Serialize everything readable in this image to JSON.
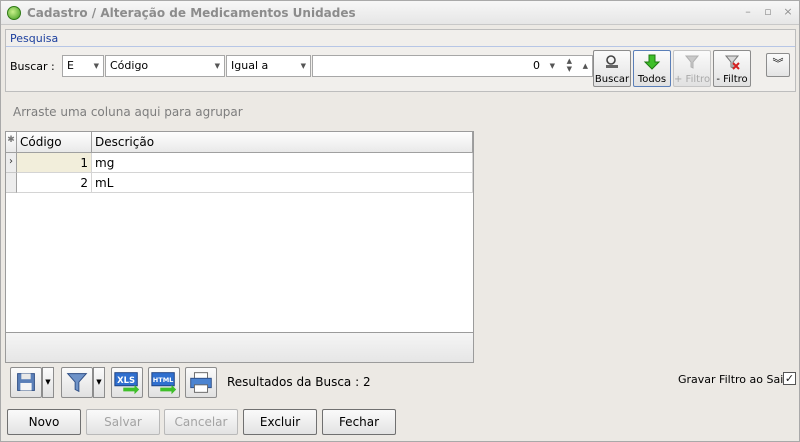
{
  "window": {
    "title": "Cadastro / Alteração de Medicamentos Unidades"
  },
  "pesquisa": {
    "label": "Pesquisa",
    "buscar_label": "Buscar :",
    "logic": "E",
    "field": "Código",
    "operator": "Igual a",
    "value": "0",
    "buttons": {
      "buscar": "Buscar",
      "todos": "Todos",
      "add_filtro": "+ Filtro",
      "remove_filtro": "- Filtro"
    }
  },
  "grid": {
    "group_hint": "Arraste uma coluna aqui para agrupar",
    "columns": [
      "Código",
      "Descrição"
    ],
    "rows": [
      {
        "codigo": "1",
        "descricao": "mg"
      },
      {
        "codigo": "2",
        "descricao": "mL"
      }
    ]
  },
  "status": {
    "resultados": "Resultados da Busca : 2",
    "gravar_filtro": "Gravar Filtro ao Sair",
    "gravar_checked": "✓"
  },
  "actions": {
    "novo": "Novo",
    "salvar": "Salvar",
    "cancelar": "Cancelar",
    "excluir": "Excluir",
    "fechar": "Fechar"
  }
}
